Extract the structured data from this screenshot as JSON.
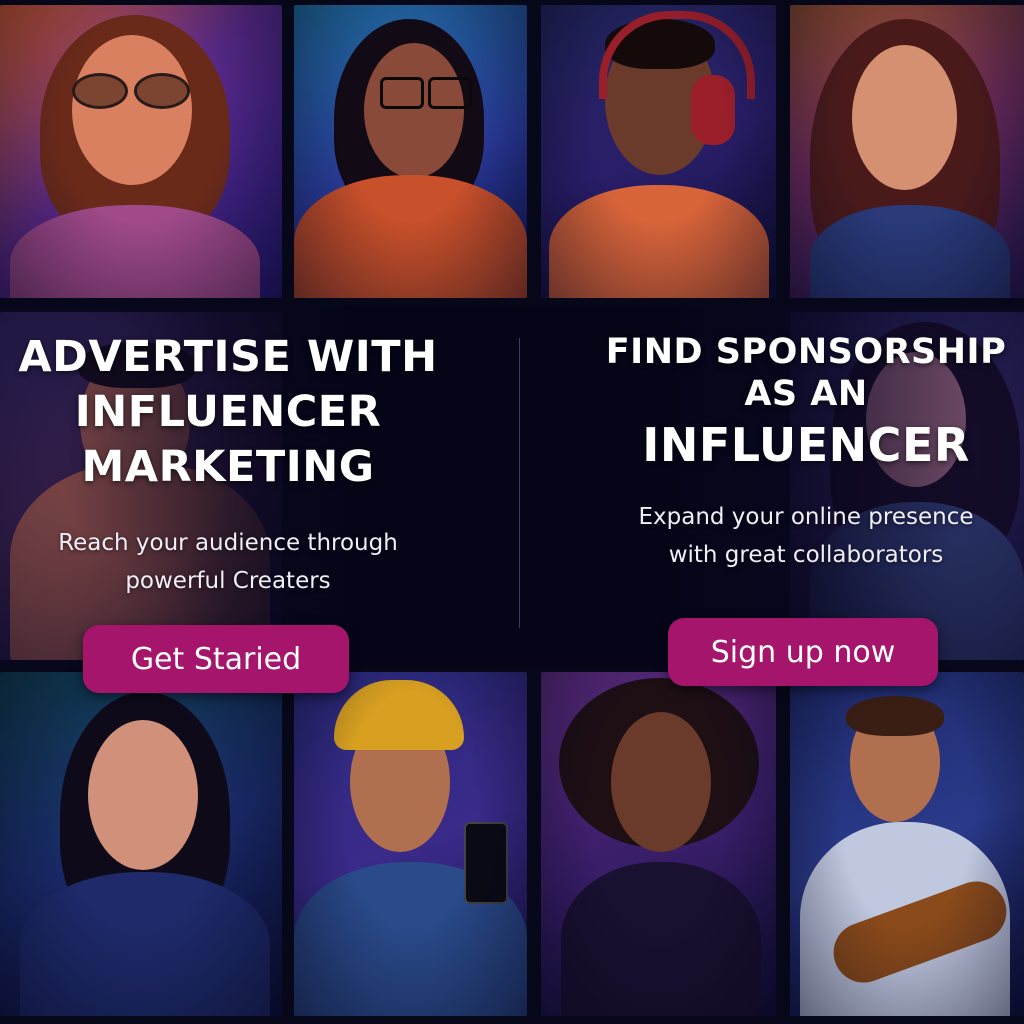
{
  "left_column": {
    "headline": [
      "ADVERTISE WITH",
      "INFLUENCER",
      "MARKETING"
    ],
    "subtext": [
      "Reach your audience through",
      "powerful Creaters"
    ],
    "button_label": "Get Staried"
  },
  "right_column": {
    "headline": [
      "FIND SPONSORSHIP",
      "AS AN",
      "INFLUENCER"
    ],
    "subtext": [
      "Expand your online presence",
      "with great collaborators"
    ],
    "button_label": "Sign up now"
  },
  "colors": {
    "background": "#07071a",
    "button": "#a4156b",
    "text": "#ffffff"
  },
  "photo_tiles": [
    {
      "name": "photo-woman-sunglasses"
    },
    {
      "name": "photo-woman-glasses-turtleneck"
    },
    {
      "name": "photo-man-headphones"
    },
    {
      "name": "photo-woman-long-hair"
    },
    {
      "name": "photo-man-guitar-left"
    },
    {
      "name": "photo-woman-smiling-right"
    },
    {
      "name": "photo-woman-smiling"
    },
    {
      "name": "photo-woman-yellow-beanie-phone"
    },
    {
      "name": "photo-woman-curly-hair"
    },
    {
      "name": "photo-man-playing-guitar"
    }
  ]
}
